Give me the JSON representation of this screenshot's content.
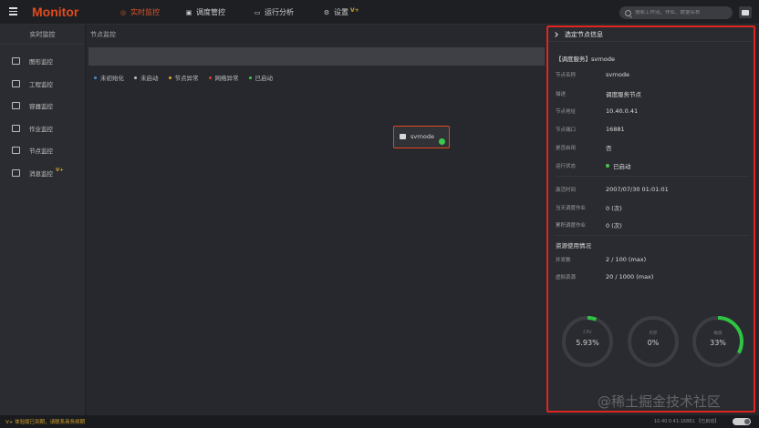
{
  "app": {
    "brand": "Monitor",
    "nav": [
      {
        "label": "实时监控",
        "active": true
      },
      {
        "label": "调度管控",
        "active": false
      },
      {
        "label": "运行分析",
        "active": false
      },
      {
        "label": "设置",
        "active": false,
        "badge": "V+"
      }
    ],
    "search_placeholder": "搜索工作流、作业、数据名称"
  },
  "sidebar": {
    "title": "实时监控",
    "items": [
      {
        "label": "图形监控",
        "icon": "monitor-icon"
      },
      {
        "label": "工程监控",
        "icon": "project-icon"
      },
      {
        "label": "容器监控",
        "icon": "container-icon"
      },
      {
        "label": "作业监控",
        "icon": "job-list-icon"
      },
      {
        "label": "节点监控",
        "icon": "node-tree-icon"
      },
      {
        "label": "消息监控",
        "icon": "message-icon",
        "badge": "V+"
      }
    ]
  },
  "main": {
    "title": "节点监控",
    "legend": [
      {
        "label": "未初始化",
        "color": "#3d8fd6"
      },
      {
        "label": "未启动",
        "color": "#bdbdbd"
      },
      {
        "label": "节点异常",
        "color": "#e0a92a"
      },
      {
        "label": "网络异常",
        "color": "#e0392a"
      },
      {
        "label": "已启动",
        "color": "#3ec84b"
      }
    ],
    "node": {
      "label": "svrnode",
      "status_color": "#3ec84b"
    }
  },
  "info": {
    "header": "选定节点信息",
    "service_title": "【调度服务】svrnode",
    "fields": [
      {
        "key": "节点名称",
        "value": "svrnode"
      },
      {
        "key": "描述",
        "value": "调度服务节点"
      },
      {
        "key": "节点地址",
        "value": "10.40.0.41"
      },
      {
        "key": "节点端口",
        "value": "16881"
      },
      {
        "key": "是否启用",
        "value": "否"
      },
      {
        "key": "运行状态",
        "value": "已启动"
      }
    ],
    "stats": [
      {
        "key": "激活时间",
        "value": "2007/07/30 01:01:01"
      },
      {
        "key": "当天调度作业",
        "value": "0 (次)"
      },
      {
        "key": "累积调度作业",
        "value": "0 (次)"
      }
    ],
    "resource_title": "资源使用情况",
    "resources": [
      {
        "key": "并发数",
        "value": "2 / 100 (max)"
      },
      {
        "key": "虚拟资源",
        "value": "20 / 1000 (max)"
      }
    ],
    "gauges": [
      {
        "name": "CPU",
        "value": "5.93%",
        "fraction": 0.0593
      },
      {
        "name": "内存",
        "value": "0%",
        "fraction": 0
      },
      {
        "name": "磁盘",
        "value": "33%",
        "fraction": 0.33
      }
    ]
  },
  "watermark": "@稀土掘金技术社区",
  "status": {
    "warning": "V+ 体验版已到期，请联系商务续期",
    "right": "10.40.0.41:16881 【已启动】"
  }
}
